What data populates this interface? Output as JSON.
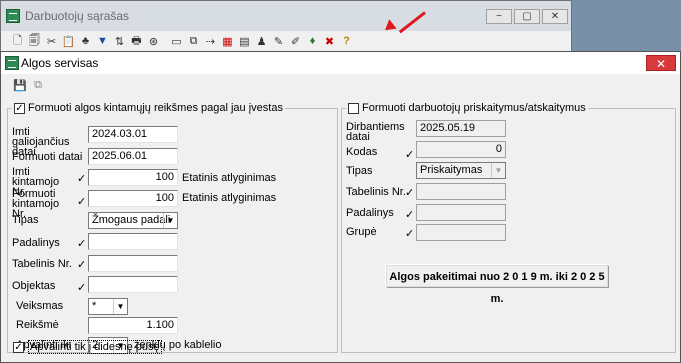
{
  "back_window": {
    "title": "Darbuotojų sąrašas",
    "buttons": [
      "−",
      "▢",
      "✕"
    ],
    "toolbar_icons": [
      "new-icon",
      "copy-icon",
      "scissors-icon",
      "paste-icon",
      "tree-icon",
      "filter-icon",
      "sort-icon",
      "printer-icon",
      "binoculars-icon",
      "sep",
      "doc-icon",
      "copy2-icon",
      "export-icon",
      "calendar-icon",
      "chart-icon",
      "person-icon",
      "sign-icon",
      "edit-icon",
      "coins-icon",
      "tools-icon",
      "help-icon"
    ]
  },
  "dialog": {
    "title": "Algos servisas",
    "close": "✕",
    "left": {
      "checkbox_label": "Formuoti algos kintamųjų reikšmes pagal jau įvestas",
      "checked": true,
      "imti_galiojancius_label": "Imti galiojančius datai",
      "imti_galiojancius_value": "2024.03.01",
      "formuoti_datai_label": "Formuoti datai",
      "formuoti_datai_value": "2025.06.01",
      "imti_kintamojo_label": "Imti kintamojo Nr.",
      "imti_kintamojo_value": "100",
      "imti_kintamojo_desc": "Etatinis atlyginimas",
      "formuoti_kintamojo_label": "Formuoti kintamojo Nr.",
      "formuoti_kintamojo_value": "100",
      "formuoti_kintamojo_desc": "Etatinis atlyginimas",
      "tipas_label": "Tipas",
      "tipas_value": "Žmogaus padali",
      "padalinys_label": "Padalinys",
      "tabelinis_label": "Tabelinis Nr.",
      "objektas_label": "Objektas",
      "veiksmas_label": "Veiksmas",
      "veiksmas_value": "*",
      "reiksme_label": "Reikšmė",
      "reiksme_value": "1.100",
      "apvalinti_label": "Apvalinti iki",
      "apvalinti_value": "2",
      "apvalinti_desc": "ženklų po kablelio",
      "apvalinti_tik_label": "Apvalinti tik į didesnę pusę",
      "apvalinti_tik_checked": true
    },
    "right": {
      "checkbox_label": "Formuoti darbuotojų priskaitymus/atskaitymus",
      "checked": false,
      "dirbantiems_label": "Dirbantiems datai",
      "dirbantiems_value": "2025.05.19",
      "kodas_label": "Kodas",
      "kodas_value": "0",
      "tipas_label": "Tipas",
      "tipas_value": "Priskaitymas",
      "tabelinis_label": "Tabelinis Nr.",
      "padalinys_label": "Padalinys",
      "grupe_label": "Grupė"
    },
    "action_button": "Algos pakeitimai nuo  2 0 1 9 m.  iki  2 0 2 5 m."
  },
  "colors": {
    "arrow": "#e0161b",
    "close": "#d63a3a"
  }
}
